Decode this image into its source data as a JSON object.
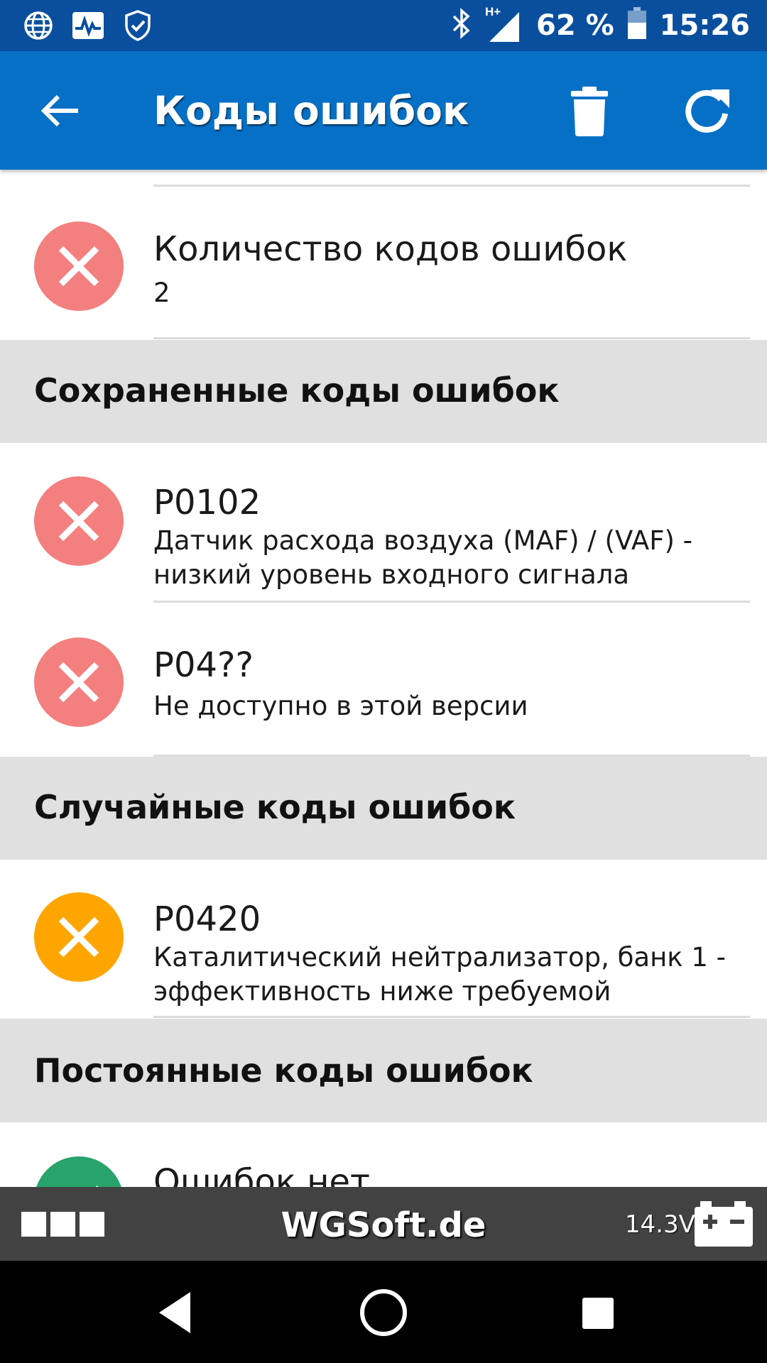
{
  "status_bar": {
    "icons": [
      "globe-icon",
      "activity-icon",
      "shield-icon",
      "bluetooth-icon",
      "signal-icon",
      "battery-icon"
    ],
    "network_label": "H+",
    "battery": "62 %",
    "time": "15:26"
  },
  "app_bar": {
    "title": "Коды ошибок",
    "icons": [
      "back-arrow-icon",
      "trash-icon",
      "refresh-icon"
    ]
  },
  "summary": {
    "title": "Количество кодов ошибок",
    "value": "2",
    "status_color": "#f47f7f"
  },
  "sections": [
    {
      "label": "Сохраненные коды ошибок",
      "items": [
        {
          "code": "P0102",
          "description": "Датчик расхода воздуха (MAF) / (VAF) - низкий уровень входного сигнала",
          "status_color": "#f47f7f"
        },
        {
          "code": "P04??",
          "description": "Не доступно в этой версии",
          "status_color": "#f47f7f"
        }
      ]
    },
    {
      "label": "Случайные коды ошибок",
      "items": [
        {
          "code": "P0420",
          "description": "Каталитический нейтрализатор, банк 1 - эффективность ниже требуемой",
          "status_color": "#ffa500"
        }
      ]
    },
    {
      "label": "Постоянные коды ошибок",
      "items": [
        {
          "code": "Ошибок нет",
          "description": "",
          "status_color": "#27a36b"
        }
      ]
    }
  ],
  "footer": {
    "brand": "WGSoft.de",
    "voltage": "14.3V"
  },
  "colors": {
    "status_bar": "#0a4f9e",
    "app_bar": "#0670c6",
    "section_bg": "#e0e0e0",
    "footer_bg": "#424242"
  }
}
